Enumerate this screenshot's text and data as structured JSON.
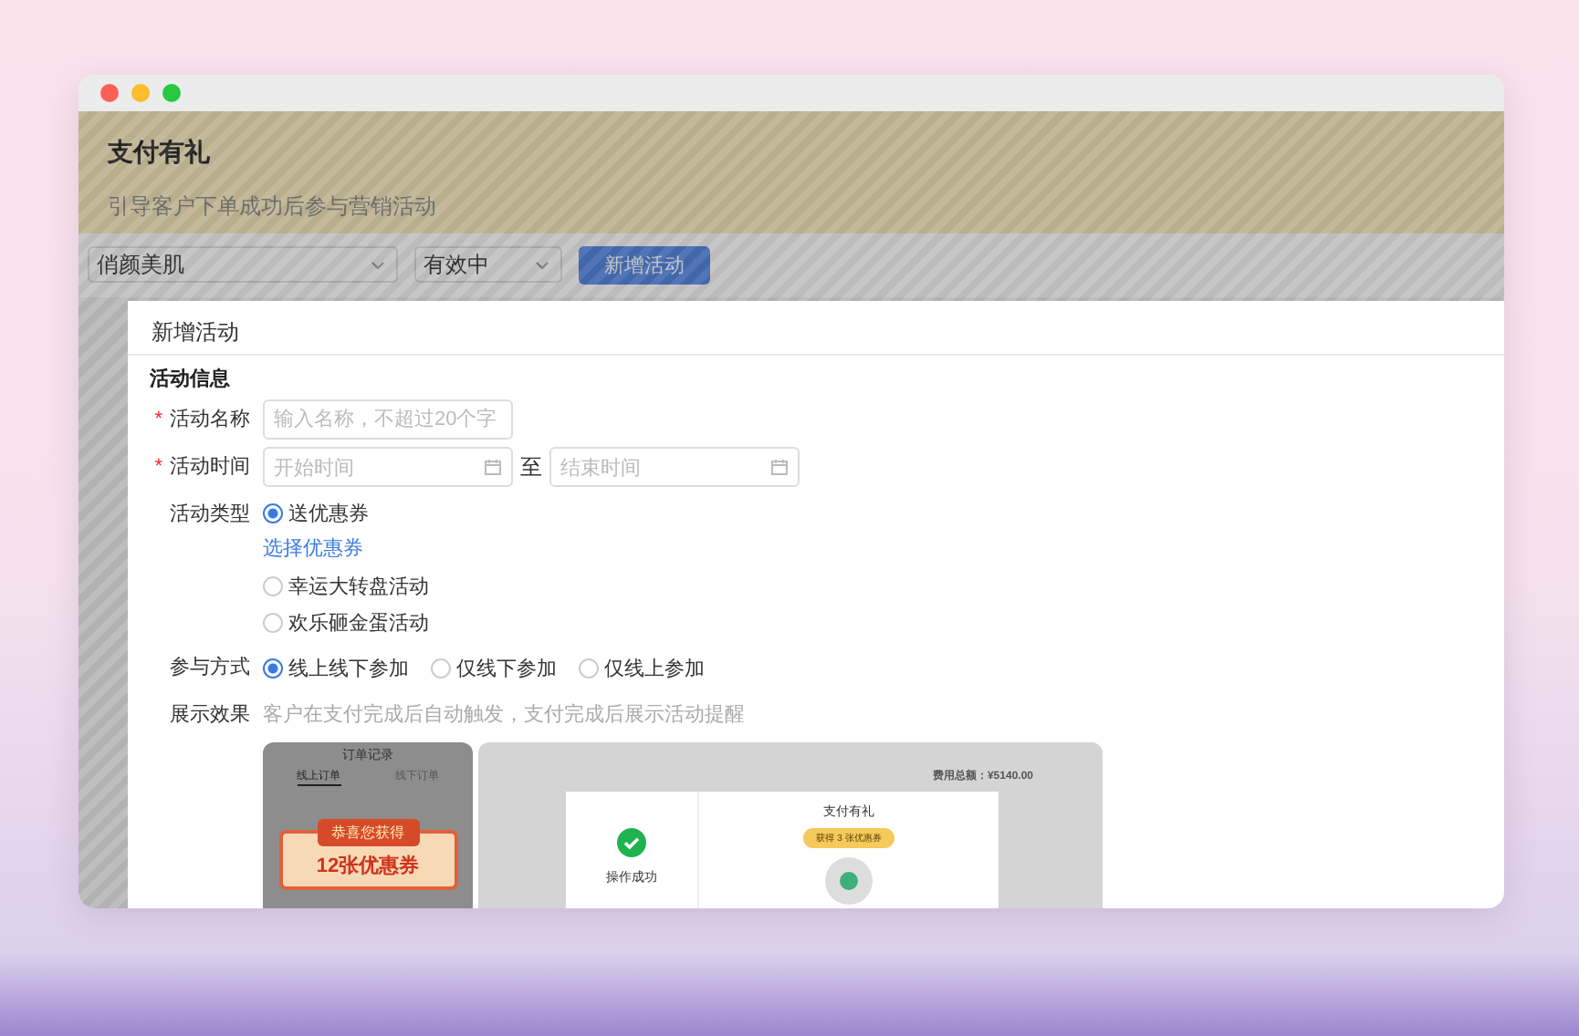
{
  "header": {
    "title": "支付有礼",
    "subtitle": "引导客户下单成功后参与营销活动"
  },
  "filters": {
    "shop": "俏颜美肌",
    "status": "有效中",
    "add_button": "新增活动"
  },
  "modal": {
    "title": "新增活动",
    "section": "活动信息",
    "fields": [
      {
        "kind": "text",
        "label": "活动名称",
        "required_mark": "*",
        "placeholder": "输入名称，不超过20个字"
      },
      {
        "kind": "daterange",
        "label": "活动时间",
        "required_mark": "*",
        "start_placeholder": "开始时间",
        "separator": "至",
        "end_placeholder": "结束时间"
      },
      {
        "kind": "radio-list",
        "label": "活动类型",
        "options": [
          {
            "label": "送优惠券",
            "selected": true,
            "link": "选择优惠券"
          },
          {
            "label": "幸运大转盘活动",
            "selected": false
          },
          {
            "label": "欢乐砸金蛋活动",
            "selected": false
          }
        ]
      },
      {
        "kind": "radio",
        "label": "参与方式",
        "options": [
          {
            "label": "线上线下参加",
            "selected": true
          },
          {
            "label": "仅线下参加",
            "selected": false
          },
          {
            "label": "仅线上参加",
            "selected": false
          }
        ]
      },
      {
        "kind": "note",
        "label": "展示效果",
        "text": "客户在支付完成后自动触发，支付完成后展示活动提醒"
      }
    ],
    "preview": {
      "phone": {
        "title": "订单记录",
        "tabs": [
          {
            "label": "线上订单",
            "selected": true
          },
          {
            "label": "线下订单",
            "selected": false
          }
        ],
        "banner": "恭喜您获得",
        "prize": "12张优惠券"
      },
      "desktop": {
        "amount": "费用总额：¥5140.00",
        "dialog": {
          "status": "操作成功",
          "title": "支付有礼",
          "badge": "获得 3 张优惠券"
        }
      }
    }
  }
}
